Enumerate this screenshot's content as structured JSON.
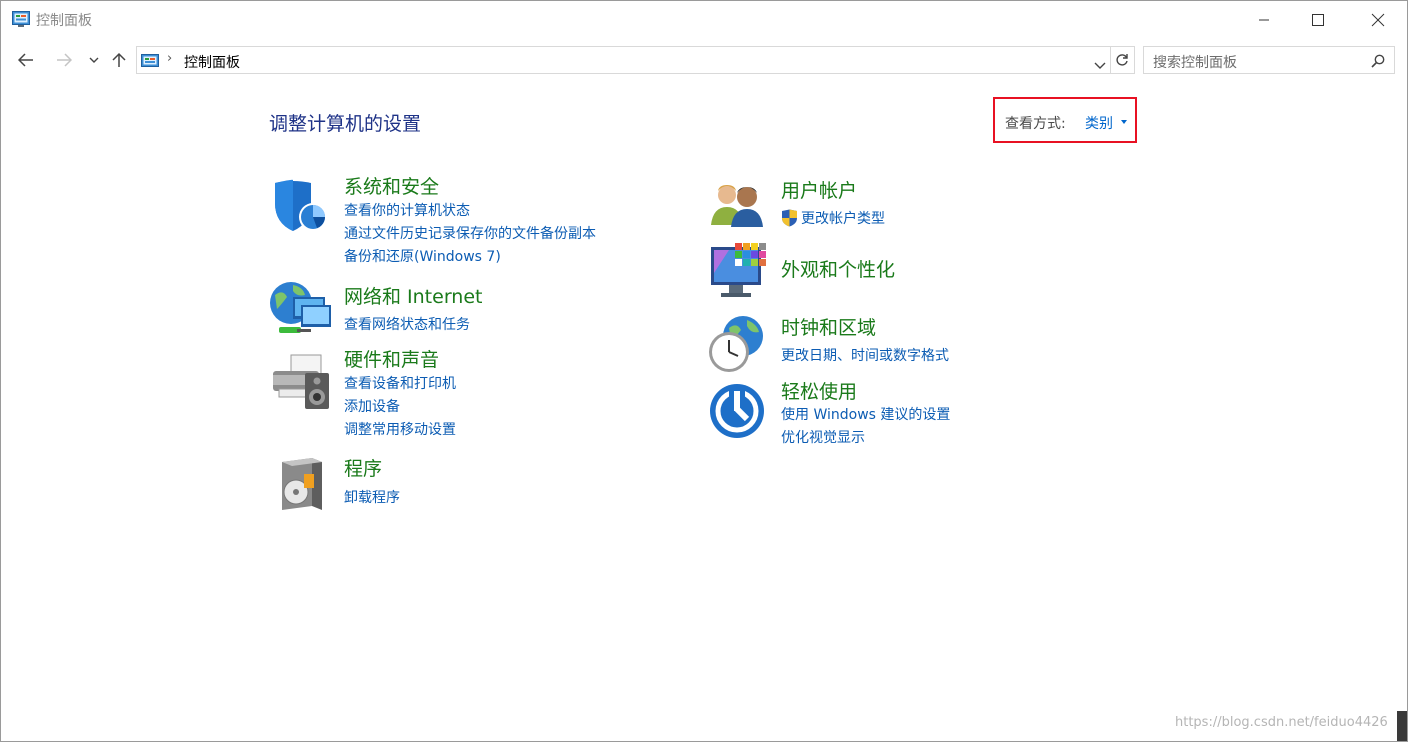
{
  "window": {
    "title": "控制面板"
  },
  "nav": {
    "back": "back-arrow-icon",
    "forward": "forward-arrow-icon",
    "recent": "chevron-down-icon",
    "up": "up-arrow-icon"
  },
  "address": {
    "separator": "›",
    "path": "控制面板"
  },
  "search": {
    "placeholder": "搜索控制面板"
  },
  "main": {
    "heading": "调整计算机的设置",
    "view_by": {
      "label": "查看方式:",
      "value": "类别"
    }
  },
  "categories": [
    {
      "title": "系统和安全",
      "icon": "shield-icon",
      "links": [
        "查看你的计算机状态",
        "通过文件历史记录保存你的文件备份副本",
        "备份和还原(Windows 7)"
      ]
    },
    {
      "title": "网络和 Internet",
      "icon": "network-icon",
      "links": [
        "查看网络状态和任务"
      ]
    },
    {
      "title": "硬件和声音",
      "icon": "printer-speaker-icon",
      "links": [
        "查看设备和打印机",
        "添加设备",
        "调整常用移动设置"
      ]
    },
    {
      "title": "程序",
      "icon": "programs-icon",
      "links": [
        "卸载程序"
      ]
    },
    {
      "title": "用户帐户",
      "icon": "users-icon",
      "links": [
        "更改帐户类型"
      ]
    },
    {
      "title": "外观和个性化",
      "icon": "display-personalize-icon",
      "links": []
    },
    {
      "title": "时钟和区域",
      "icon": "clock-globe-icon",
      "links": [
        "更改日期、时间或数字格式"
      ]
    },
    {
      "title": "轻松使用",
      "icon": "accessibility-icon",
      "links": [
        "使用 Windows 建议的设置",
        "优化视觉显示"
      ]
    }
  ],
  "watermark": "https://blog.csdn.net/feiduo4426",
  "colors": {
    "heading": "#1e3287",
    "category": "#1a7a1a",
    "link": "#0c5cb3",
    "highlight_border": "#e81123"
  }
}
